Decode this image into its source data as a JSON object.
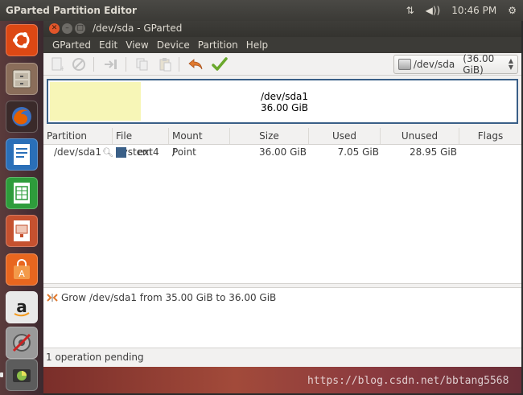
{
  "top_panel": {
    "app_title": "GParted Partition Editor",
    "network_indicator": "⇅",
    "volume_indicator": "◀))",
    "clock": "10:46 PM",
    "settings_indicator": "⚙"
  },
  "launcher": {
    "items": [
      {
        "name": "dash-home",
        "color": "#dd4814"
      },
      {
        "name": "files",
        "color": "#8a6d5a"
      },
      {
        "name": "firefox",
        "color": "#e66000"
      },
      {
        "name": "libreoffice-writer",
        "color": "#2a6fb8"
      },
      {
        "name": "libreoffice-calc",
        "color": "#2e9c3b"
      },
      {
        "name": "libreoffice-impress",
        "color": "#c5512f"
      },
      {
        "name": "ubuntu-software-center",
        "color": "#e8661f"
      },
      {
        "name": "amazon",
        "color": "#e9e9e9"
      },
      {
        "name": "system-settings",
        "color": "#9a9a9a"
      },
      {
        "name": "gparted",
        "color": "#5c5c5c"
      }
    ]
  },
  "window": {
    "title": "/dev/sda - GParted",
    "menu": [
      "GParted",
      "Edit",
      "View",
      "Device",
      "Partition",
      "Help"
    ]
  },
  "device_selector": {
    "name": "/dev/sda",
    "size": "(36.00 GiB)"
  },
  "partition_visual": {
    "name": "/dev/sda1",
    "size": "36.00 GiB",
    "used_fraction": 0.196
  },
  "table": {
    "columns": [
      "Partition",
      "File System",
      "Mount Point",
      "Size",
      "Used",
      "Unused",
      "Flags"
    ],
    "rows": [
      {
        "partition": "/dev/sda1",
        "filesystem": "ext4",
        "filesystem_color": "#3a5f87",
        "mount_point": "/",
        "size": "36.00 GiB",
        "used": "7.05 GiB",
        "unused": "28.95 GiB",
        "flags": ""
      }
    ]
  },
  "operations": [
    {
      "text": "Grow /dev/sda1 from 35.00 GiB to 36.00 GiB"
    }
  ],
  "status_bar": {
    "text": "1 operation pending"
  },
  "watermark": "https://blog.csdn.net/bbtang5568"
}
